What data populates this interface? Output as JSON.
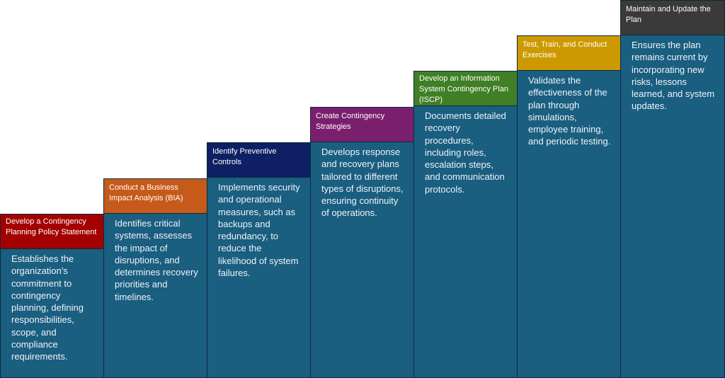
{
  "diagram": {
    "type": "staircase-process",
    "steps": [
      {
        "title": "Develop a Contingency Planning Policy Statement",
        "description": "Establishes the organization's commitment to contingency planning, defining responsibilities, scope, and compliance requirements.",
        "color": "#a30000"
      },
      {
        "title": "Conduct a Business Impact Analysis (BIA)",
        "description": "Identifies critical systems, assesses the impact of disruptions, and determines recovery priorities and timelines.",
        "color": "#c55a1a"
      },
      {
        "title": "Identify Preventive Controls",
        "description": "Implements security and operational measures, such as backups and redundancy, to reduce the likelihood of system failures.",
        "color": "#0e1f63"
      },
      {
        "title": "Create Contingency Strategies",
        "description": "Develops response and recovery plans tailored to different types of disruptions, ensuring continuity of operations.",
        "color": "#7a1f6e"
      },
      {
        "title": "Develop an Information System Contingency Plan (ISCP)",
        "description": "Documents detailed recovery procedures, including roles, escalation steps, and communication protocols.",
        "color": "#3f7f26"
      },
      {
        "title": "Test, Train, and Conduct Exercises",
        "description": "Validates the effectiveness of the plan through simulations, employee training, and periodic testing.",
        "color": "#cc9a00"
      },
      {
        "title": "Maintain and Update the Plan",
        "description": "Ensures the plan remains current by incorporating new risks, lessons learned, and system updates.",
        "color": "#3a3a3a"
      }
    ],
    "body_color": "#1a5e80"
  }
}
